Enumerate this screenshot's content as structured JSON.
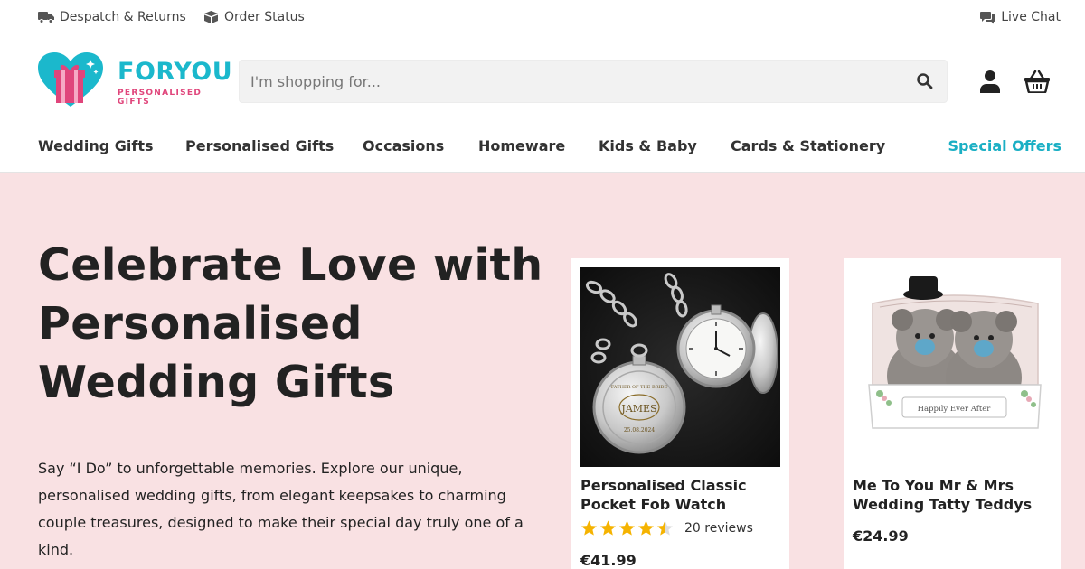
{
  "utility": {
    "despatch_label": "Despatch & Returns",
    "order_label": "Order Status",
    "chat_label": "Live Chat"
  },
  "brand": {
    "name": "FORYOU",
    "tagline": "PERSONALISED GIFTS",
    "primary_color": "#1bb8cc",
    "accent_color": "#e0457b"
  },
  "search": {
    "placeholder": "I'm shopping for..."
  },
  "nav": {
    "items": [
      "Wedding Gifts",
      "Personalised Gifts",
      "Occasions",
      "Homeware",
      "Kids & Baby",
      "Cards & Stationery"
    ],
    "special": "Special Offers"
  },
  "hero": {
    "background": "#f9e1e3",
    "title": "Celebrate Love with Personalised Wedding Gifts",
    "description": "Say “I Do” to unforgettable memories. Explore our unique, personalised wedding gifts, from elegant keepsakes to charming couple treasures, designed to make their special day truly one of a kind."
  },
  "products": [
    {
      "title": "Personalised Classic Pocket Fob Watch",
      "rating": 4.5,
      "rating_max": 5,
      "reviews": "20 reviews",
      "price": "€41.99",
      "image_icon": "pocket-watch-photo",
      "engraving": [
        "JAMES",
        "FATHER OF THE BRIDE",
        "25.08.2024"
      ]
    },
    {
      "title": "Me To You Mr & Mrs Wedding Tatty Teddys",
      "price": "€24.99",
      "image_icon": "teddy-bears-photo",
      "box_label": "Happily Ever After"
    }
  ],
  "icons": {
    "despatch": "truck-icon",
    "order": "box-icon",
    "chat": "chat-icon",
    "search": "search-icon",
    "account": "user-icon",
    "basket": "basket-icon",
    "star_color": "#f5b301"
  }
}
